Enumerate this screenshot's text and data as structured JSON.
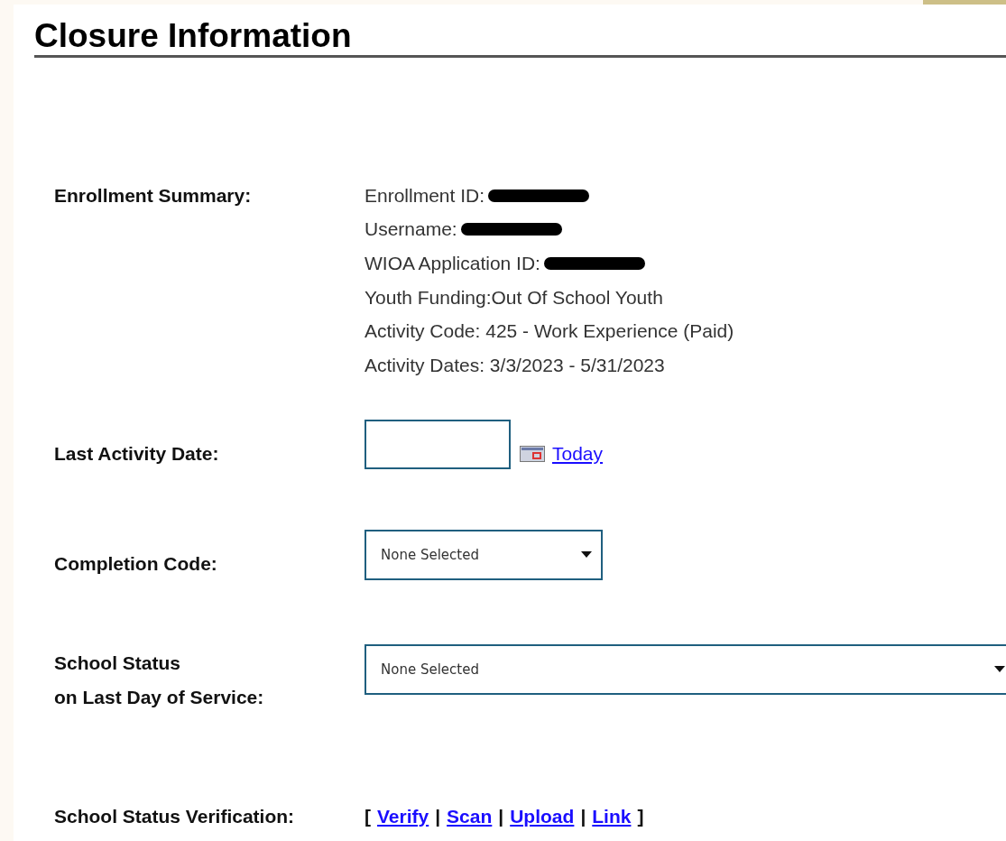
{
  "heading": "Closure Information",
  "summary": {
    "label": "Enrollment Summary:",
    "lines": [
      {
        "text": "Enrollment ID:",
        "redacted": true
      },
      {
        "text": "Username:",
        "redacted": true
      },
      {
        "text": "WIOA Application ID:",
        "redacted": true
      },
      {
        "text": "Youth Funding:Out Of School Youth",
        "redacted": false
      },
      {
        "text": "Activity Code: 425 - Work Experience (Paid)",
        "redacted": false
      },
      {
        "text": "Activity Dates: 3/3/2023 - 5/31/2023",
        "redacted": false
      }
    ]
  },
  "last_activity_date": {
    "label": "Last Activity Date:",
    "today_link": "Today"
  },
  "completion_code": {
    "label": "Completion Code:",
    "value": "None Selected"
  },
  "school_status": {
    "label_lines": [
      "School Status",
      "on Last Day of Service:"
    ],
    "value": "None Selected"
  },
  "verification": {
    "label": "School Status Verification:",
    "open": "[",
    "links": [
      "Verify",
      "Scan",
      "Upload",
      "Link"
    ],
    "separators": [
      "|",
      "|",
      "|"
    ],
    "close": "]"
  }
}
